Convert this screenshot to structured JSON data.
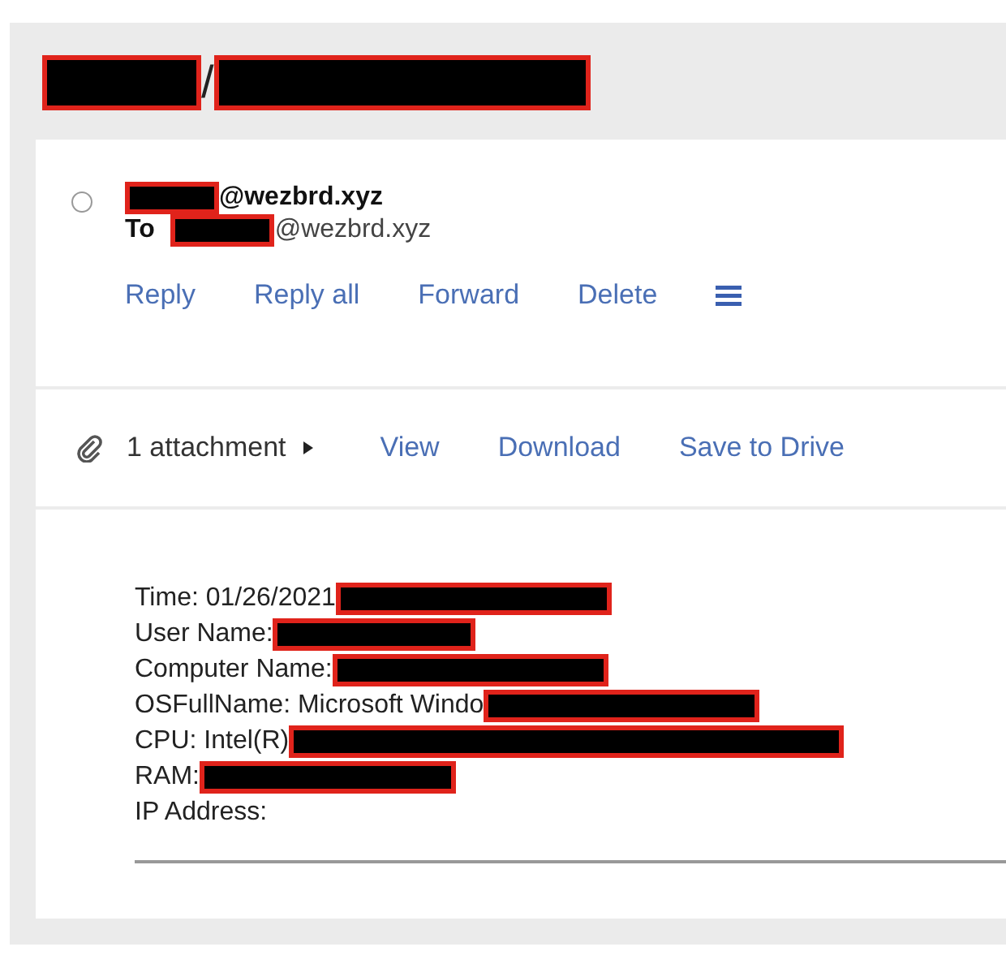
{
  "subject": [
    {
      "kind": "redaction"
    },
    {
      "kind": "text",
      "text": "/"
    },
    {
      "kind": "redaction"
    }
  ],
  "message": {
    "selected": false,
    "from": [
      {
        "kind": "redaction"
      },
      {
        "kind": "text",
        "text": "@wezbrd.xyz"
      }
    ],
    "to_label": "To",
    "to": [
      {
        "kind": "redaction"
      },
      {
        "kind": "text",
        "text": "@wezbrd.xyz"
      }
    ],
    "actions": [
      "Reply",
      "Reply all",
      "Forward",
      "Delete"
    ]
  },
  "attachments": {
    "label": "1 attachment",
    "actions": [
      "View",
      "Download",
      "Save to Drive"
    ]
  },
  "body": [
    [
      {
        "kind": "text",
        "text": "Time: 01/26/2021"
      },
      {
        "kind": "redaction"
      }
    ],
    [
      {
        "kind": "text",
        "text": "User Name:"
      },
      {
        "kind": "redaction"
      }
    ],
    [
      {
        "kind": "text",
        "text": "Computer Name:"
      },
      {
        "kind": "redaction"
      }
    ],
    [
      {
        "kind": "text",
        "text": "OSFullName: Microsoft Windo"
      },
      {
        "kind": "redaction"
      }
    ],
    [
      {
        "kind": "text",
        "text": "CPU: Intel(R)"
      },
      {
        "kind": "redaction"
      }
    ],
    [
      {
        "kind": "text",
        "text": "RAM:"
      },
      {
        "kind": "redaction"
      }
    ],
    [
      {
        "kind": "text",
        "text": "IP Address:"
      }
    ]
  ]
}
